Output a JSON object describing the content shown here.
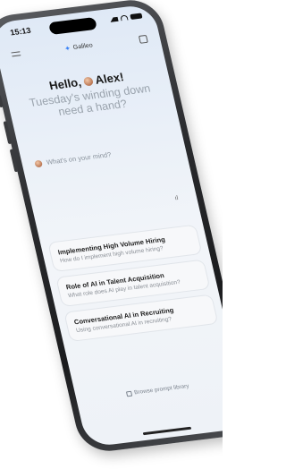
{
  "status": {
    "time": "15:13"
  },
  "header": {
    "brand": "Galileo"
  },
  "greeting": {
    "hello": "Hello,",
    "name": "Alex!",
    "subtitle": "Tuesday's winding down\nneed a hand?"
  },
  "input": {
    "placeholder": "What's on your mind?"
  },
  "prompts": [
    {
      "title": "Implementing High Volume Hiring",
      "description": "How do I implement high volume hiring?"
    },
    {
      "title": "Role of AI in Talent Acquisition",
      "description": "What role does AI play in talent acquisition?"
    },
    {
      "title": "Conversational AI in Recruiting",
      "description": "Using conversational AI in recruiting?"
    }
  ],
  "footer": {
    "browse_label": "Browse prompt library"
  },
  "colors": {
    "accent": "#3b82f6",
    "frame": "#2a2b2e"
  }
}
